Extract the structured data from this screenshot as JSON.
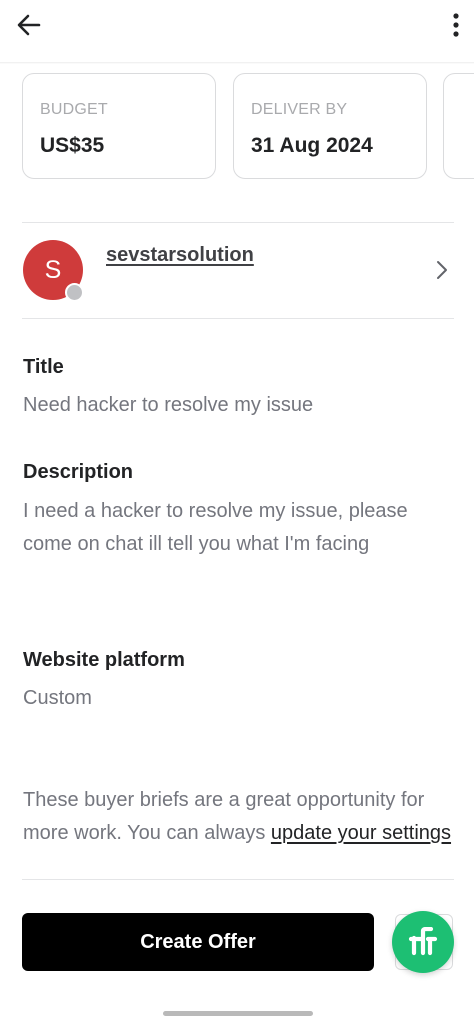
{
  "header": {
    "back_icon": "arrow-left-icon",
    "menu_icon": "kebab-vertical-icon"
  },
  "cards": [
    {
      "label": "BUDGET",
      "value": "US$35"
    },
    {
      "label": "DELIVER BY",
      "value": "31 Aug 2024"
    }
  ],
  "buyer": {
    "initial": "S",
    "username": "sevstarsolution",
    "status_color": "#c0c1c4",
    "avatar_color": "#cf3b3b"
  },
  "sections": [
    {
      "title": "Title",
      "text": "Need hacker to resolve my issue"
    },
    {
      "title": "Description",
      "text": "I need a hacker to resolve my issue, please come on chat ill tell you what I'm facing"
    },
    {
      "title": "Website platform",
      "text": "Custom"
    }
  ],
  "footer_note": {
    "text": "These buyer briefs are a great opportunity for more work. You can always ",
    "link": "update your settings"
  },
  "actions": {
    "create_offer": "Create Offer",
    "fab_logo": "fi"
  },
  "colors": {
    "accent": "#1dbf73",
    "primary_button": "#000000"
  }
}
